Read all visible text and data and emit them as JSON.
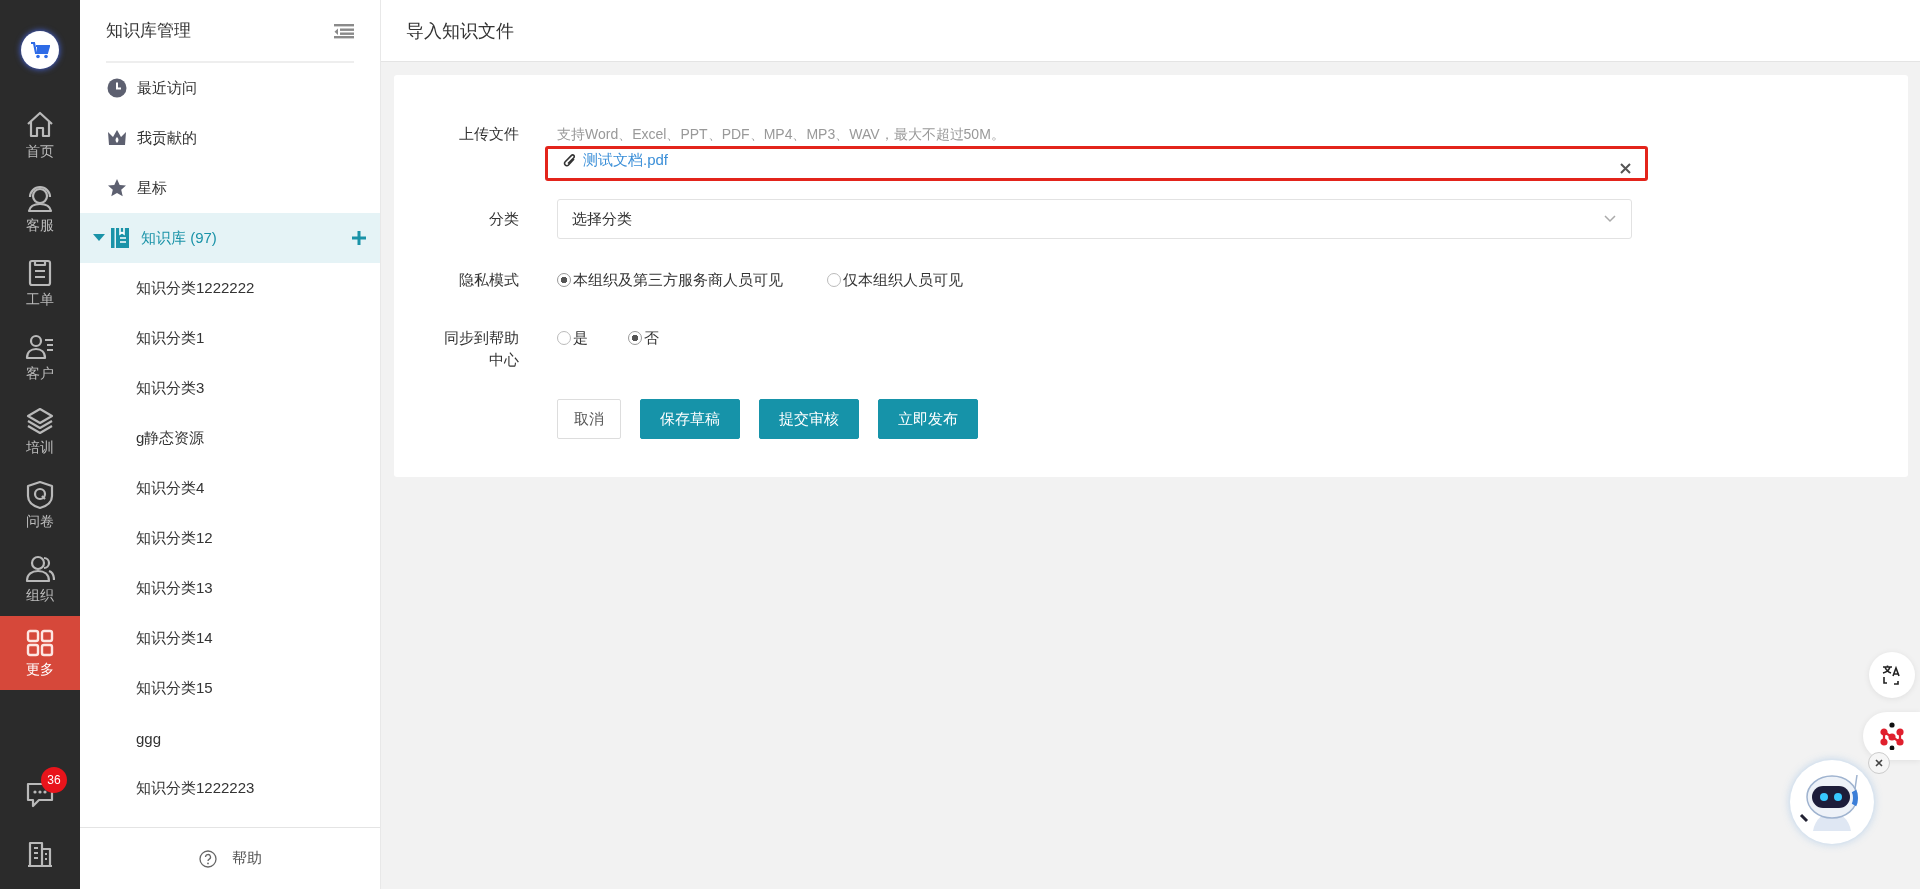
{
  "nav": {
    "items": [
      {
        "label": "首页",
        "selected": false
      },
      {
        "label": "客服",
        "selected": false
      },
      {
        "label": "工单",
        "selected": false
      },
      {
        "label": "客户",
        "selected": false
      },
      {
        "label": "培训",
        "selected": false
      },
      {
        "label": "问卷",
        "selected": false
      },
      {
        "label": "组织",
        "selected": false
      },
      {
        "label": "更多",
        "selected": true
      }
    ],
    "message_badge": "36"
  },
  "sidebar": {
    "title": "知识库管理",
    "quick_items": [
      {
        "label": "最近访问"
      },
      {
        "label": "我贡献的"
      },
      {
        "label": "星标"
      }
    ],
    "tree": {
      "label": "知识库",
      "count": "(97)",
      "expanded": true,
      "selected": true,
      "children": [
        {
          "label": "知识分类1222222"
        },
        {
          "label": "知识分类1"
        },
        {
          "label": "知识分类3"
        },
        {
          "label": "g静态资源"
        },
        {
          "label": "知识分类4"
        },
        {
          "label": "知识分类12"
        },
        {
          "label": "知识分类13"
        },
        {
          "label": "知识分类14"
        },
        {
          "label": "知识分类15"
        },
        {
          "label": "ggg"
        },
        {
          "label": "知识分类1222223"
        }
      ]
    },
    "footer": "帮助"
  },
  "main": {
    "title": "导入知识文件",
    "form": {
      "upload": {
        "label": "上传文件",
        "hint": "支持Word、Excel、PPT、PDF、MP4、MP3、WAV，最大不超过50M。",
        "file_name": "测试文档.pdf",
        "highlighted": true
      },
      "category": {
        "label": "分类",
        "value": "选择分类"
      },
      "privacy": {
        "label": "隐私模式",
        "options": [
          {
            "label": "本组织及第三方服务商人员可见",
            "selected": true
          },
          {
            "label": "仅本组织人员可见",
            "selected": false
          }
        ]
      },
      "sync": {
        "label": "同步到帮助中心",
        "options": [
          {
            "label": "是",
            "selected": false
          },
          {
            "label": "否",
            "selected": true
          }
        ]
      },
      "buttons": [
        {
          "label": "取消",
          "kind": "default"
        },
        {
          "label": "保存草稿",
          "kind": "primary"
        },
        {
          "label": "提交审核",
          "kind": "primary"
        },
        {
          "label": "立即发布",
          "kind": "primary"
        }
      ]
    }
  }
}
